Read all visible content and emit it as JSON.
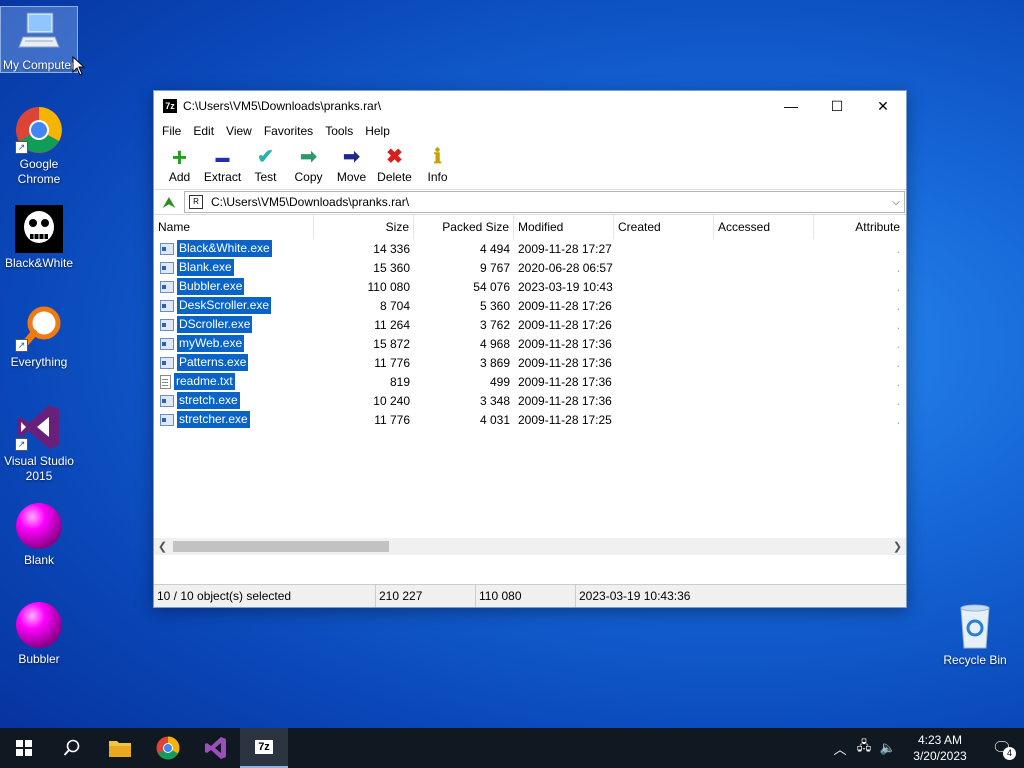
{
  "desktop": {
    "icons": [
      {
        "label": "My Computer"
      },
      {
        "label": "Google Chrome"
      },
      {
        "label": "Black&White"
      },
      {
        "label": "Everything"
      },
      {
        "label": "Visual Studio 2015"
      },
      {
        "label": "Blank"
      },
      {
        "label": "Bubbler"
      },
      {
        "label": "Recycle Bin"
      }
    ]
  },
  "window": {
    "title": "C:\\Users\\VM5\\Downloads\\pranks.rar\\",
    "app_icon_text": "7z",
    "minimize": "—",
    "maximize": "☐",
    "close": "✕"
  },
  "menu": [
    "File",
    "Edit",
    "View",
    "Favorites",
    "Tools",
    "Help"
  ],
  "toolbar": [
    {
      "label": "Add",
      "icon": "plus-icon",
      "glyph": "+",
      "color": "#1fa01f"
    },
    {
      "label": "Extract",
      "icon": "minus-icon",
      "glyph": "▬",
      "color": "#1e2fb0"
    },
    {
      "label": "Test",
      "icon": "checkmark-icon",
      "glyph": "✔",
      "color": "#2ab0b0"
    },
    {
      "label": "Copy",
      "icon": "copy-arrow-icon",
      "glyph": "➡",
      "color": "#2a9a6a"
    },
    {
      "label": "Move",
      "icon": "move-arrow-icon",
      "glyph": "➡",
      "color": "#1e2a8a"
    },
    {
      "label": "Delete",
      "icon": "delete-x-icon",
      "glyph": "✖",
      "color": "#d81e1e"
    },
    {
      "label": "Info",
      "icon": "info-icon",
      "glyph": "ℹ",
      "color": "#c8a000"
    }
  ],
  "address": {
    "path": "C:\\Users\\VM5\\Downloads\\pranks.rar\\"
  },
  "columns": {
    "name": "Name",
    "size": "Size",
    "packed": "Packed Size",
    "modified": "Modified",
    "created": "Created",
    "accessed": "Accessed",
    "attributes": "Attribute"
  },
  "files": [
    {
      "name": "Black&White.exe",
      "size": "14 336",
      "packed": "4 494",
      "modified": "2009-11-28 17:27",
      "type": "exe"
    },
    {
      "name": "Blank.exe",
      "size": "15 360",
      "packed": "9 767",
      "modified": "2020-06-28 06:57",
      "type": "exe"
    },
    {
      "name": "Bubbler.exe",
      "size": "110 080",
      "packed": "54 076",
      "modified": "2023-03-19 10:43",
      "type": "exe"
    },
    {
      "name": "DeskScroller.exe",
      "size": "8 704",
      "packed": "5 360",
      "modified": "2009-11-28 17:26",
      "type": "exe"
    },
    {
      "name": "DScroller.exe",
      "size": "11 264",
      "packed": "3 762",
      "modified": "2009-11-28 17:26",
      "type": "exe"
    },
    {
      "name": "myWeb.exe",
      "size": "15 872",
      "packed": "4 968",
      "modified": "2009-11-28 17:36",
      "type": "exe"
    },
    {
      "name": "Patterns.exe",
      "size": "11 776",
      "packed": "3 869",
      "modified": "2009-11-28 17:36",
      "type": "exe"
    },
    {
      "name": "readme.txt",
      "size": "819",
      "packed": "499",
      "modified": "2009-11-28 17:36",
      "type": "txt"
    },
    {
      "name": "stretch.exe",
      "size": "10 240",
      "packed": "3 348",
      "modified": "2009-11-28 17:36",
      "type": "exe"
    },
    {
      "name": "stretcher.exe",
      "size": "11 776",
      "packed": "4 031",
      "modified": "2009-11-28 17:25",
      "type": "exe"
    }
  ],
  "status": {
    "selection": "10 / 10 object(s) selected",
    "total_size": "210 227",
    "selected_size": "110 080",
    "date": "2023-03-19 10:43:36"
  },
  "taskbar": {
    "time": "4:23 AM",
    "date": "3/20/2023",
    "notifications": "4",
    "active_app": "7z"
  }
}
